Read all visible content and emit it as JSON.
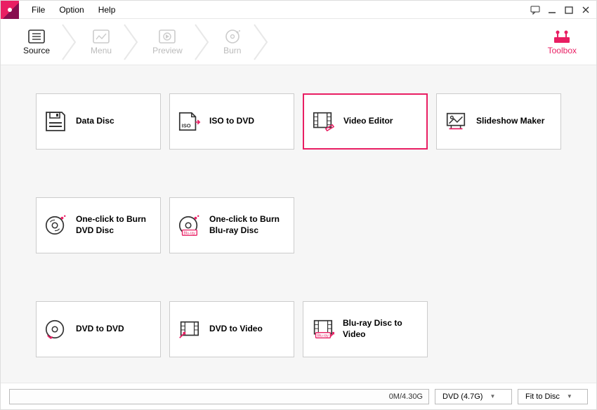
{
  "menu": {
    "file": "File",
    "option": "Option",
    "help": "Help"
  },
  "steps": {
    "source": "Source",
    "menu": "Menu",
    "preview": "Preview",
    "burn": "Burn"
  },
  "toolbox_label": "Toolbox",
  "tiles": {
    "data_disc": "Data Disc",
    "iso_to_dvd": "ISO to DVD",
    "video_editor": "Video Editor",
    "slideshow_maker": "Slideshow Maker",
    "oneclick_dvd": "One-click to Burn DVD Disc",
    "oneclick_bluray": "One-click to Burn Blu-ray Disc",
    "dvd_to_dvd": "DVD to DVD",
    "dvd_to_video": "DVD to Video",
    "bluray_to_video": "Blu-ray Disc to Video"
  },
  "status": {
    "progress": "0M/4.30G",
    "disc_type": "DVD (4.7G)",
    "fit": "Fit to Disc"
  }
}
